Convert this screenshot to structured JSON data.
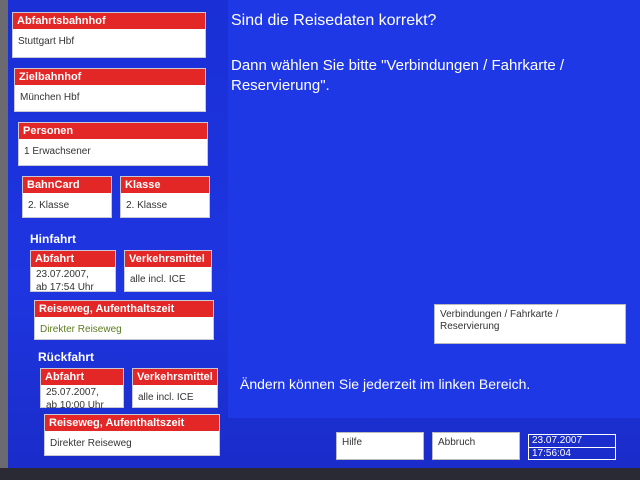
{
  "sidebar": {
    "departure_station": {
      "label": "Abfahrtsbahnhof",
      "value": "Stuttgart Hbf"
    },
    "destination_station": {
      "label": "Zielbahnhof",
      "value": "München Hbf"
    },
    "persons": {
      "label": "Personen",
      "value": "1 Erwachsener"
    },
    "bahncard": {
      "label": "BahnCard",
      "value": "2. Klasse"
    },
    "class": {
      "label": "Klasse",
      "value": "2. Klasse"
    },
    "outbound": {
      "heading": "Hinfahrt",
      "departure": {
        "label": "Abfahrt",
        "line1": "23.07.2007,",
        "line2": "ab 17:54 Uhr"
      },
      "transport": {
        "label": "Verkehrsmittel",
        "value": "alle incl. ICE"
      },
      "route": {
        "label": "Reiseweg, Aufenthaltszeit",
        "value": "Direkter Reiseweg"
      }
    },
    "return": {
      "heading": "Rückfahrt",
      "departure": {
        "label": "Abfahrt",
        "line1": "25.07.2007,",
        "line2": "ab 10:00 Uhr"
      },
      "transport": {
        "label": "Verkehrsmittel",
        "value": "alle incl. ICE"
      },
      "route": {
        "label": "Reiseweg, Aufenthaltszeit",
        "value": "Direkter Reiseweg"
      }
    }
  },
  "main": {
    "title": "Sind die Reisedaten korrekt?",
    "instruction": "Dann wählen Sie bitte \"Verbindungen / Fahrkarte / Reservierung\".",
    "hint": "Ändern können Sie jederzeit im linken Bereich.",
    "connections_button": "Verbindungen / Fahrkarte / Reservierung"
  },
  "footer": {
    "help_button": "Hilfe",
    "cancel_button": "Abbruch",
    "date": "23.07.2007",
    "time": "17:56:04"
  },
  "colors": {
    "background": "#1f38e6",
    "header_red": "#e32626",
    "field_white": "#ffffff"
  }
}
